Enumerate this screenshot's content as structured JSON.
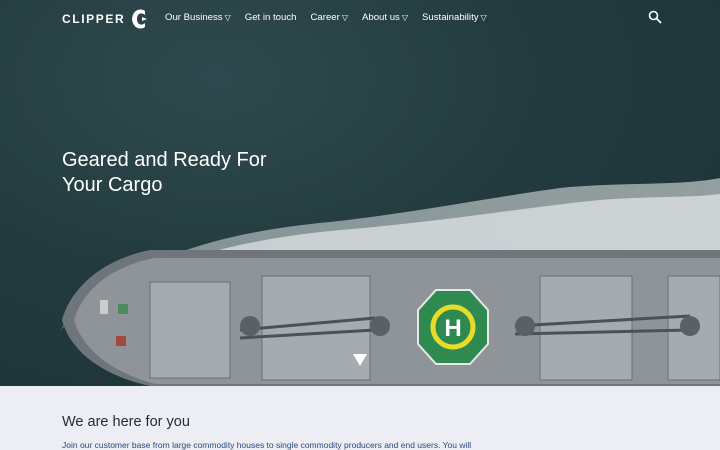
{
  "brand": {
    "name": "CLIPPER"
  },
  "nav": {
    "items": [
      {
        "label": "Our Business",
        "caret": "▽"
      },
      {
        "label": "Get in touch",
        "caret": ""
      },
      {
        "label": "Career",
        "caret": "▽"
      },
      {
        "label": "About us",
        "caret": "▽"
      },
      {
        "label": "Sustainability",
        "caret": "▽"
      }
    ],
    "search_icon": "search-icon"
  },
  "hero": {
    "title_line1": "Geared and Ready For",
    "title_line2": "Your Cargo",
    "helipad_letter": "H",
    "scroll_icon": "chevron-down-icon"
  },
  "intro": {
    "heading": "We are here for you",
    "text": "Join our customer base from large commodity houses to single commodity producers and end users. You will"
  },
  "colors": {
    "sea": "#233b3f",
    "deck": "#8e9498",
    "helipad_green": "#2f8a4f",
    "helipad_yellow": "#e8dc2a",
    "page_bg": "#eceef3",
    "intro_heading": "#1f2b3a",
    "intro_text": "#2c4a7a"
  }
}
